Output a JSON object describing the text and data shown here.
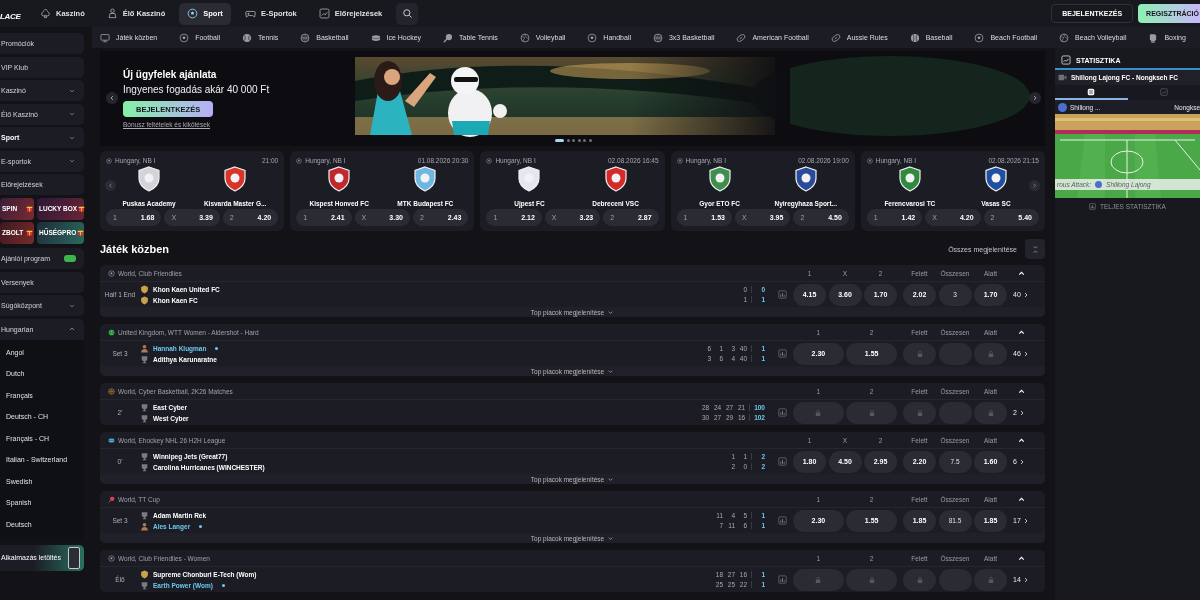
{
  "topbar": {
    "logo": "LACE",
    "nav": [
      {
        "label": "Kaszinó",
        "kind": "spade",
        "selected": false
      },
      {
        "label": "Élő Kaszinó",
        "kind": "dealer",
        "selected": false
      },
      {
        "label": "Sport",
        "kind": "ball",
        "selected": true
      },
      {
        "label": "E-Sportok",
        "kind": "gamepad",
        "selected": false
      },
      {
        "label": "Előrejelzések",
        "kind": "chart",
        "selected": false
      }
    ],
    "login": "BEJELENTKEZÉS",
    "register": "REGISZTRÁCIÓ"
  },
  "sidebar": {
    "items": [
      {
        "kind": "link",
        "label": "Promóciók",
        "selected": false,
        "badge": false
      },
      {
        "kind": "link",
        "label": "VIP Klub",
        "selected": false,
        "badge": false
      },
      {
        "kind": "menu",
        "label": "Kaszinó",
        "selected": false,
        "expanded": false
      },
      {
        "kind": "menu",
        "label": "Élő Kaszinó",
        "selected": false,
        "expanded": false
      },
      {
        "kind": "menu",
        "label": "Sport",
        "selected": true,
        "expanded": false
      },
      {
        "kind": "menu",
        "label": "E-sportok",
        "selected": false,
        "expanded": false
      },
      {
        "kind": "link",
        "label": "Előrejelzések",
        "selected": false,
        "badge": false
      },
      {
        "kind": "tiles",
        "tiles": [
          {
            "label": "SPIN"
          },
          {
            "label": "LUCKY BOX"
          },
          {
            "label": "ZBOLT"
          },
          {
            "label": "HŰSÉGPRO"
          }
        ]
      },
      {
        "kind": "link",
        "label": "Ajánlói program",
        "selected": false,
        "badge": true
      },
      {
        "kind": "link",
        "label": "Versenyek",
        "selected": false,
        "badge": false
      },
      {
        "kind": "menu",
        "label": "Súgóközpont",
        "selected": false,
        "expanded": false
      },
      {
        "kind": "menu",
        "label": "Hungarian",
        "selected": false,
        "expanded": true,
        "children": [
          {
            "label": "Angol"
          },
          {
            "label": "Dutch"
          },
          {
            "label": "Français"
          },
          {
            "label": "Deutsch - CH"
          },
          {
            "label": "Français - CH"
          },
          {
            "label": "Italian - Switzerland"
          },
          {
            "label": "Swedish"
          },
          {
            "label": "Spanish"
          },
          {
            "label": "Deutsch"
          }
        ]
      },
      {
        "kind": "app",
        "label": "Alkalmazás letöltés"
      }
    ]
  },
  "sports": [
    {
      "label": "Játék közben",
      "kind": "live"
    },
    {
      "label": "Football",
      "kind": "ball"
    },
    {
      "label": "Tennis",
      "kind": "tennis"
    },
    {
      "label": "Basketball",
      "kind": "basket"
    },
    {
      "label": "Ice Hockey",
      "kind": "puck"
    },
    {
      "label": "Table Tennis",
      "kind": "paddle"
    },
    {
      "label": "Volleyball",
      "kind": "volley"
    },
    {
      "label": "Handball",
      "kind": "ball"
    },
    {
      "label": "3x3 Basketball",
      "kind": "basket"
    },
    {
      "label": "American Football",
      "kind": "oval"
    },
    {
      "label": "Aussie Rules",
      "kind": "oval"
    },
    {
      "label": "Baseball",
      "kind": "baseball"
    },
    {
      "label": "Beach Football",
      "kind": "ball"
    },
    {
      "label": "Beach Volleyball",
      "kind": "volley"
    },
    {
      "label": "Boxing",
      "kind": "glove"
    }
  ],
  "banner": {
    "title": "Új ügyfelek ajánlata",
    "subtitle": "Ingyenes fogadás akár 40 000 Ft",
    "button": "BEJELENTKEZÉS",
    "link": "Bónusz feltételek és kikötések",
    "slides": [
      {
        "selected": true
      },
      {
        "selected": false
      },
      {
        "selected": false
      },
      {
        "selected": false
      },
      {
        "selected": false
      },
      {
        "selected": false
      }
    ]
  },
  "featured": [
    {
      "league": "Hungary, NB I",
      "time": "21:00",
      "home": {
        "name": "Puskas Academy",
        "color": "#d4d4d8"
      },
      "away": {
        "name": "Kisvarda Master G...",
        "color": "#d8352a"
      },
      "odds": [
        {
          "label": "1",
          "value": "1.68"
        },
        {
          "label": "X",
          "value": "3.39"
        },
        {
          "label": "2",
          "value": "4.20"
        }
      ]
    },
    {
      "league": "Hungary, NB I",
      "time": "01.08.2026 20:30",
      "home": {
        "name": "Kispest Honved FC",
        "color": "#c0282d"
      },
      "away": {
        "name": "MTK Budapest FC",
        "color": "#6fb7e0"
      },
      "odds": [
        {
          "label": "1",
          "value": "2.41"
        },
        {
          "label": "X",
          "value": "3.30"
        },
        {
          "label": "2",
          "value": "2.43"
        }
      ]
    },
    {
      "league": "Hungary, NB I",
      "time": "02.08.2026 16:45",
      "home": {
        "name": "Ujpest FC",
        "color": "#e6e6ee"
      },
      "away": {
        "name": "Debreceni VSC",
        "color": "#d42a2a"
      },
      "odds": [
        {
          "label": "1",
          "value": "2.12"
        },
        {
          "label": "X",
          "value": "3.23"
        },
        {
          "label": "2",
          "value": "2.87"
        }
      ]
    },
    {
      "league": "Hungary, NB I",
      "time": "02.08.2026 19:00",
      "home": {
        "name": "Gyor ETO FC",
        "color": "#3f8f4a"
      },
      "away": {
        "name": "Nyiregyhaza Sport...",
        "color": "#2a4a9a"
      },
      "odds": [
        {
          "label": "1",
          "value": "1.53"
        },
        {
          "label": "X",
          "value": "3.95"
        },
        {
          "label": "2",
          "value": "4.50"
        }
      ]
    },
    {
      "league": "Hungary, NB I",
      "time": "02.08.2026 21:15",
      "home": {
        "name": "Ferencvarosi TC",
        "color": "#2f8a3e"
      },
      "away": {
        "name": "Vasas SC",
        "color": "#1f4fa0"
      },
      "odds": [
        {
          "label": "1",
          "value": "1.42"
        },
        {
          "label": "X",
          "value": "4.20"
        },
        {
          "label": "2",
          "value": "5.40"
        }
      ]
    }
  ],
  "live": {
    "title": "Játék közben",
    "show_all": "Összes megjelenítése",
    "events": [
      {
        "league": "World, Club Friendlies",
        "kind": "football",
        "expanded": true,
        "columns": [
          "1",
          "X",
          "2",
          "Felett",
          "Összesen",
          "Alatt"
        ],
        "status": "Half 1 End",
        "teams": [
          {
            "name": "Khon Kaen United FC",
            "kind": "crest",
            "serving": false,
            "scores": [
              "0"
            ],
            "total": "0"
          },
          {
            "name": "Khon Kaen FC",
            "kind": "crest",
            "serving": false,
            "scores": [
              "1"
            ],
            "total": "1"
          }
        ],
        "odds": [
          {
            "kind": "odd",
            "value": "4.15"
          },
          {
            "kind": "odd",
            "value": "3.60"
          },
          {
            "kind": "odd",
            "value": "1.70"
          },
          {
            "kind": "odd",
            "value": "2.02"
          },
          {
            "kind": "line",
            "value": "3"
          },
          {
            "kind": "odd",
            "value": "1.70"
          }
        ],
        "markets": "40",
        "footer": "Top piacok megjelenítése"
      },
      {
        "league": "United Kingdom, WTT Women - Aldershot - Hard",
        "kind": "tennis",
        "expanded": true,
        "columns": [
          "1",
          "2",
          "Felett",
          "Összesen",
          "Alatt"
        ],
        "status": "Set 3",
        "teams": [
          {
            "name": "Hannah Klugman",
            "kind": "avatar",
            "serving": true,
            "scores": [
              "6",
              "1",
              "3",
              "40"
            ],
            "total": "1"
          },
          {
            "name": "Adithya Karunaratne",
            "kind": "jersey",
            "serving": false,
            "scores": [
              "3",
              "6",
              "4",
              "40"
            ],
            "total": "1"
          }
        ],
        "odds": [
          {
            "kind": "odd",
            "value": "2.30"
          },
          {
            "kind": "odd",
            "value": "1.55"
          },
          {
            "kind": "locked"
          },
          {
            "kind": "empty"
          },
          {
            "kind": "locked"
          }
        ],
        "markets": "46",
        "footer": "Top piacok megjelenítése"
      },
      {
        "league": "World, Cyber Basketball, 2K26 Matches",
        "kind": "basketball",
        "expanded": true,
        "columns": [
          "1",
          "2",
          "Felett",
          "Összesen",
          "Alatt"
        ],
        "status": "2'",
        "teams": [
          {
            "name": "East Cyber",
            "kind": "jersey",
            "serving": false,
            "scores": [
              "28",
              "24",
              "27",
              "21"
            ],
            "total": "100"
          },
          {
            "name": "West Cyber",
            "kind": "jersey",
            "serving": false,
            "scores": [
              "30",
              "27",
              "29",
              "16"
            ],
            "total": "102"
          }
        ],
        "odds": [
          {
            "kind": "locked"
          },
          {
            "kind": "locked"
          },
          {
            "kind": "locked"
          },
          {
            "kind": "empty"
          },
          {
            "kind": "locked"
          }
        ],
        "markets": "2"
      },
      {
        "league": "World, Ehockey NHL 26 H2H League",
        "kind": "hockey",
        "expanded": true,
        "columns": [
          "1",
          "X",
          "2",
          "Felett",
          "Összesen",
          "Alatt"
        ],
        "status": "0'",
        "teams": [
          {
            "name": "Winnipeg Jets (Great77)",
            "kind": "jersey",
            "serving": false,
            "scores": [
              "1",
              "1"
            ],
            "total": "2"
          },
          {
            "name": "Carolina Hurricanes (WINCHESTER)",
            "kind": "jersey",
            "serving": false,
            "scores": [
              "2",
              "0"
            ],
            "total": "2"
          }
        ],
        "odds": [
          {
            "kind": "odd",
            "value": "1.80"
          },
          {
            "kind": "odd",
            "value": "4.50"
          },
          {
            "kind": "odd",
            "value": "2.95"
          },
          {
            "kind": "odd",
            "value": "2.20"
          },
          {
            "kind": "line",
            "value": "7.5"
          },
          {
            "kind": "odd",
            "value": "1.60"
          }
        ],
        "markets": "6",
        "footer": "Top piacok megjelenítése"
      },
      {
        "league": "World, TT Cup",
        "kind": "tabletennis",
        "expanded": true,
        "columns": [
          "1",
          "2",
          "Felett",
          "Összesen",
          "Alatt"
        ],
        "status": "Set 3",
        "teams": [
          {
            "name": "Adam Martin Rek",
            "kind": "jersey",
            "serving": false,
            "scores": [
              "11",
              "4",
              "5"
            ],
            "total": "1"
          },
          {
            "name": "Ales Langer",
            "kind": "avatar",
            "serving": true,
            "scores": [
              "7",
              "11",
              "6"
            ],
            "total": "1"
          }
        ],
        "odds": [
          {
            "kind": "odd",
            "value": "2.30"
          },
          {
            "kind": "odd",
            "value": "1.55"
          },
          {
            "kind": "odd",
            "value": "1.85"
          },
          {
            "kind": "line",
            "value": "81.5"
          },
          {
            "kind": "odd",
            "value": "1.85"
          }
        ],
        "markets": "17",
        "footer": "Top piacok megjelenítése"
      },
      {
        "league": "World, Club Friendlies - Women",
        "kind": "football",
        "expanded": true,
        "columns": [
          "1",
          "2",
          "Felett",
          "Összesen",
          "Alatt"
        ],
        "status": "Élő",
        "teams": [
          {
            "name": "Supreme Chonburi E-Tech (Wom)",
            "kind": "crest",
            "serving": false,
            "scores": [
              "18",
              "27",
              "16"
            ],
            "total": "1"
          },
          {
            "name": "Earth Power (Wom)",
            "kind": "jersey",
            "serving": true,
            "scores": [
              "25",
              "25",
              "22"
            ],
            "total": "1"
          }
        ],
        "odds": [
          {
            "kind": "locked"
          },
          {
            "kind": "locked"
          },
          {
            "kind": "locked"
          },
          {
            "kind": "empty"
          },
          {
            "kind": "locked"
          }
        ],
        "markets": "14"
      }
    ]
  },
  "stats": {
    "title": "STATISZTIKA",
    "match": "Shillong Lajong FC - Nongkseh FC",
    "tabs": [
      {
        "kind": "list",
        "selected": true
      },
      {
        "kind": "chart",
        "selected": false
      }
    ],
    "home": "Shillong ...",
    "away": "Nongkse",
    "event_label": "rous Attack:",
    "event_team": "Shillong Lajong",
    "full_stats": "TELJES STATISZTIKA"
  }
}
